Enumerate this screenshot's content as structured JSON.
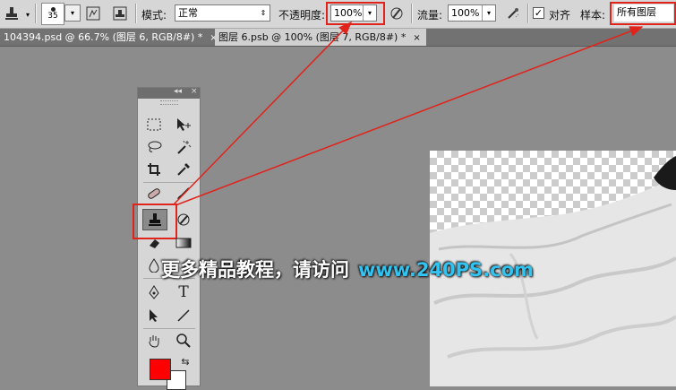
{
  "options_bar": {
    "brush_size": "35",
    "mode_label": "模式:",
    "mode_value": "正常",
    "opacity_label": "不透明度:",
    "opacity_value": "100%",
    "flow_label": "流量:",
    "flow_value": "100%",
    "align_label": "对齐",
    "align_checked": true,
    "sample_label": "样本:",
    "sample_value": "所有图层"
  },
  "tabs": [
    {
      "label": "104394.psd @ 66.7% (图层 6, RGB/8#) *",
      "close": "×",
      "active": false
    },
    {
      "label": "图层 6.psb @ 100% (图层 7, RGB/8#) *",
      "close": "×",
      "active": true
    }
  ],
  "toolbox": {
    "collapse_glyph": "◂◂",
    "close_glyph": "×"
  },
  "watermark": {
    "text": "更多精品教程，请访问",
    "url": "www.240PS.com"
  },
  "colors": {
    "foreground": "#ff0000",
    "background": "#ffffff",
    "annotation_red": "#e0241c",
    "watermark_url": "#32c3f0"
  }
}
